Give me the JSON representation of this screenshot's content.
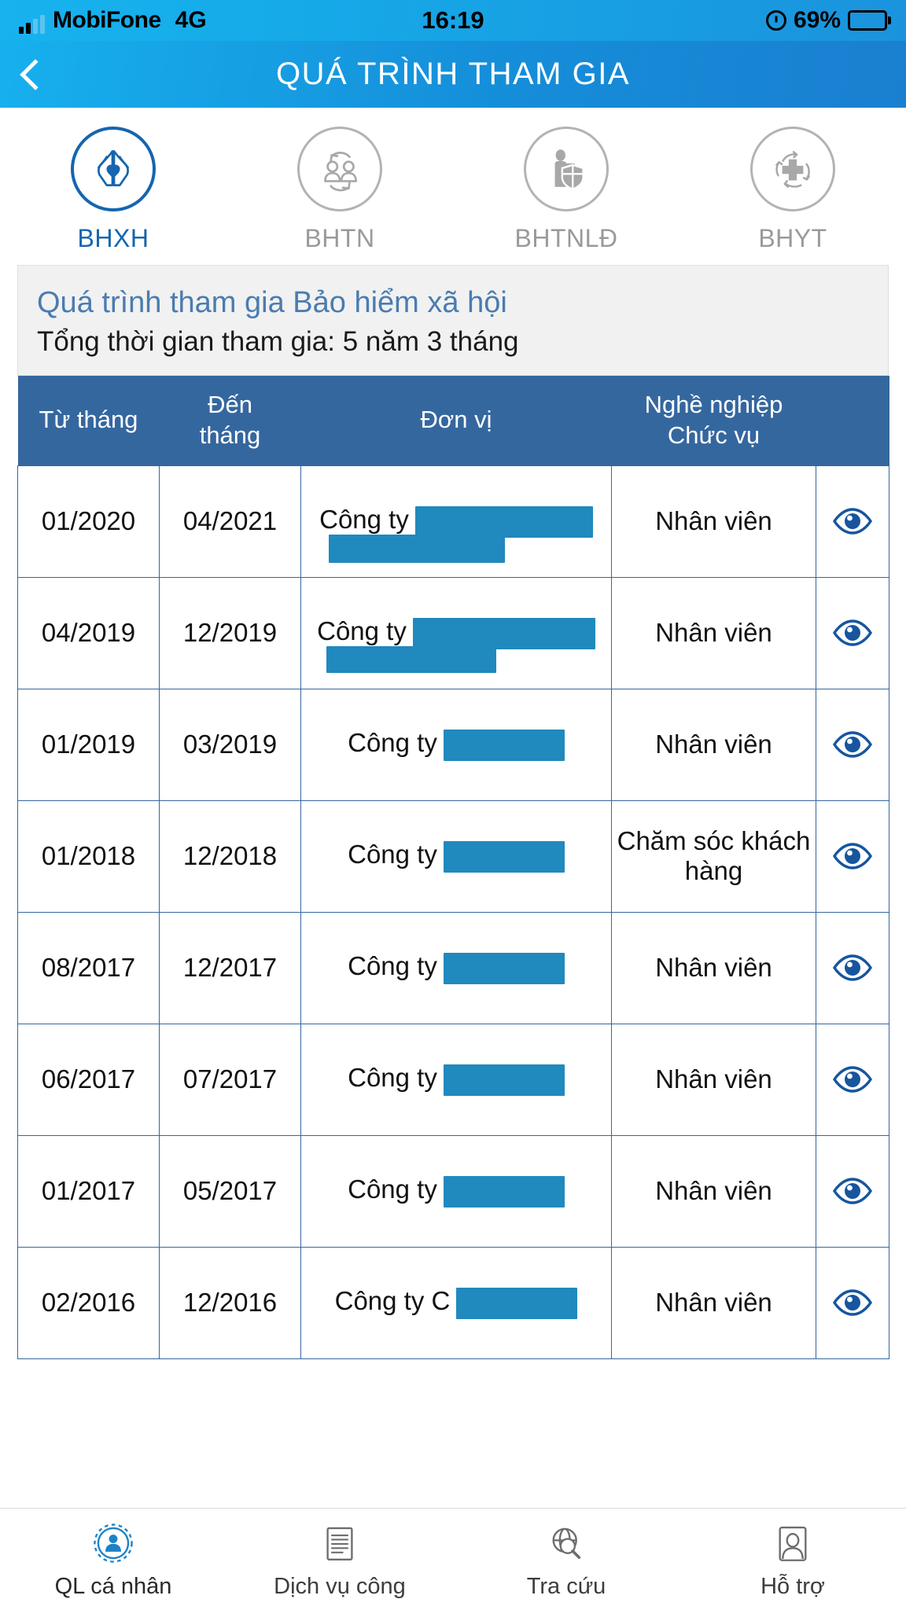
{
  "status_bar": {
    "carrier": "MobiFone",
    "network": "4G",
    "time": "16:19",
    "battery_percent": "69%",
    "signal_icon": "signal-bars-icon",
    "orientation_lock_icon": "rotation-lock-icon",
    "battery_icon": "battery-icon"
  },
  "header": {
    "back_icon": "back-chevron-icon",
    "title": "QUÁ TRÌNH THAM GIA"
  },
  "tabs": [
    {
      "label": "BHXH",
      "icon": "praying-hands-heart-icon",
      "active": true
    },
    {
      "label": "BHTN",
      "icon": "two-people-arrows-icon",
      "active": false
    },
    {
      "label": "BHTNLĐ",
      "icon": "person-shield-icon",
      "active": false
    },
    {
      "label": "BHYT",
      "icon": "medical-cross-arrows-icon",
      "active": false
    }
  ],
  "info": {
    "title": "Quá trình tham gia Bảo hiểm xã hội",
    "subtitle": "Tổng thời gian tham gia: 5 năm 3 tháng"
  },
  "table": {
    "columns": [
      "Từ tháng",
      "Đến tháng",
      "Đơn vị",
      "Nghề nghiệp Chức vụ",
      ""
    ],
    "column_headers": {
      "from": "Từ tháng",
      "to_line1": "Đến",
      "to_line2": "tháng",
      "unit": "Đơn vị",
      "job_line1": "Nghề nghiệp",
      "job_line2": "Chức vụ"
    },
    "action_icon": "eye-icon",
    "rows": [
      {
        "from": "01/2020",
        "to": "04/2021",
        "unit": "Công ty",
        "unit_redacted": true,
        "redact_w1": 226,
        "redact_w2": 224,
        "redact_h2": 36,
        "job": "Nhân viên"
      },
      {
        "from": "04/2019",
        "to": "12/2019",
        "unit": "Công ty",
        "unit_redacted": true,
        "redact_w1": 232,
        "redact_w2": 216,
        "redact_h2": 34,
        "job": "Nhân viên"
      },
      {
        "from": "01/2019",
        "to": "03/2019",
        "unit": "Công ty",
        "unit_redacted": true,
        "redact_w1": 154,
        "redact_w2": 0,
        "redact_h2": 0,
        "job": "Nhân viên"
      },
      {
        "from": "01/2018",
        "to": "12/2018",
        "unit": "Công ty",
        "unit_redacted": true,
        "redact_w1": 154,
        "redact_w2": 0,
        "redact_h2": 0,
        "job": "Chăm sóc khách hàng"
      },
      {
        "from": "08/2017",
        "to": "12/2017",
        "unit": "Công ty",
        "unit_redacted": true,
        "redact_w1": 154,
        "redact_w2": 0,
        "redact_h2": 0,
        "job": "Nhân viên"
      },
      {
        "from": "06/2017",
        "to": "07/2017",
        "unit": "Công ty",
        "unit_redacted": true,
        "redact_w1": 154,
        "redact_w2": 0,
        "redact_h2": 0,
        "job": "Nhân viên"
      },
      {
        "from": "01/2017",
        "to": "05/2017",
        "unit": "Công ty",
        "unit_redacted": true,
        "redact_w1": 154,
        "redact_w2": 0,
        "redact_h2": 0,
        "job": "Nhân viên"
      },
      {
        "from": "02/2016",
        "to": "12/2016",
        "unit": "Công ty C",
        "unit_redacted": true,
        "redact_w1": 154,
        "redact_w2": 0,
        "redact_h2": 0,
        "job": "Nhân viên"
      }
    ]
  },
  "bottom_nav": [
    {
      "label": "QL cá nhân",
      "icon": "gear-person-icon",
      "active": true
    },
    {
      "label": "Dịch vụ công",
      "icon": "document-icon",
      "active": false
    },
    {
      "label": "Tra cứu",
      "icon": "globe-search-icon",
      "active": false
    },
    {
      "label": "Hỗ trợ",
      "icon": "support-person-icon",
      "active": false
    }
  ],
  "colors": {
    "header_blue": "#158ed9",
    "table_header_blue": "#35679f",
    "accent_blue": "#1565b0",
    "redaction_blue": "#2089bd",
    "info_title_blue": "#4a7cb0"
  }
}
